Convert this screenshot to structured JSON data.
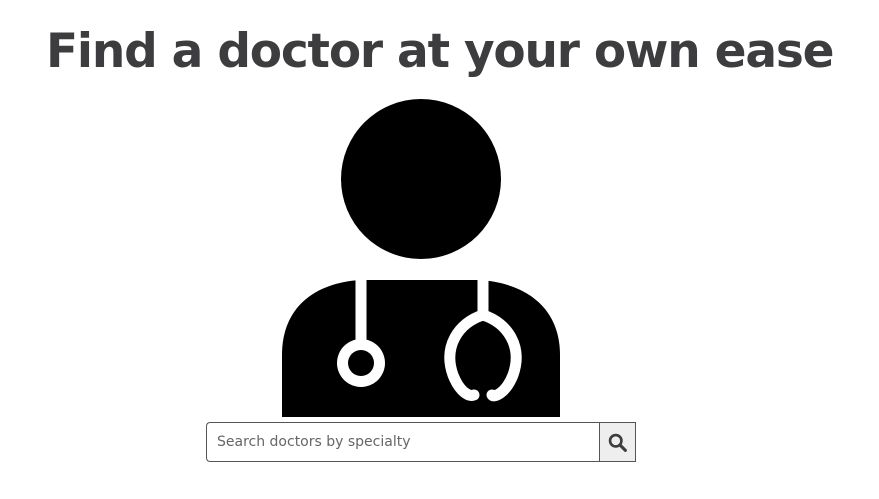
{
  "hero": {
    "headline": "Find a doctor at your own ease"
  },
  "illustration": {
    "icon": "doctor-with-stethoscope-icon"
  },
  "search": {
    "placeholder": "Search doctors by specialty",
    "value": "",
    "button_icon": "search-icon"
  },
  "colors": {
    "headline": "#3d3d3f",
    "illustration": "#000000",
    "search_button_bg": "#eeeeee",
    "search_border": "#555555"
  }
}
